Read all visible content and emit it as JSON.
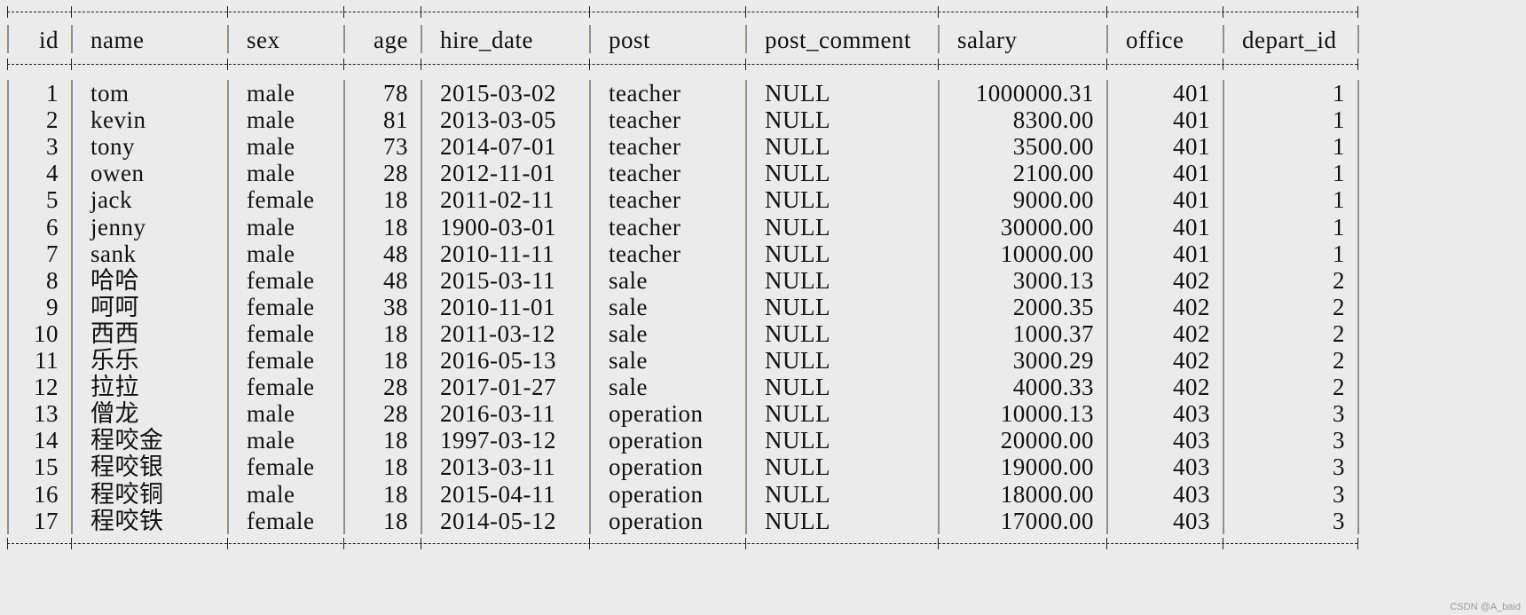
{
  "console": {
    "columns": [
      "id",
      "name",
      "sex",
      "age",
      "hire_date",
      "post",
      "post_comment",
      "salary",
      "office",
      "depart_id"
    ],
    "rows": [
      [
        "1",
        "tom",
        "male",
        "78",
        "2015-03-02",
        "teacher",
        "NULL",
        "1000000.31",
        "401",
        "1"
      ],
      [
        "2",
        "kevin",
        "male",
        "81",
        "2013-03-05",
        "teacher",
        "NULL",
        "8300.00",
        "401",
        "1"
      ],
      [
        "3",
        "tony",
        "male",
        "73",
        "2014-07-01",
        "teacher",
        "NULL",
        "3500.00",
        "401",
        "1"
      ],
      [
        "4",
        "owen",
        "male",
        "28",
        "2012-11-01",
        "teacher",
        "NULL",
        "2100.00",
        "401",
        "1"
      ],
      [
        "5",
        "jack",
        "female",
        "18",
        "2011-02-11",
        "teacher",
        "NULL",
        "9000.00",
        "401",
        "1"
      ],
      [
        "6",
        "jenny",
        "male",
        "18",
        "1900-03-01",
        "teacher",
        "NULL",
        "30000.00",
        "401",
        "1"
      ],
      [
        "7",
        "sank",
        "male",
        "48",
        "2010-11-11",
        "teacher",
        "NULL",
        "10000.00",
        "401",
        "1"
      ],
      [
        "8",
        "哈哈",
        "female",
        "48",
        "2015-03-11",
        "sale",
        "NULL",
        "3000.13",
        "402",
        "2"
      ],
      [
        "9",
        "呵呵",
        "female",
        "38",
        "2010-11-01",
        "sale",
        "NULL",
        "2000.35",
        "402",
        "2"
      ],
      [
        "10",
        "西西",
        "female",
        "18",
        "2011-03-12",
        "sale",
        "NULL",
        "1000.37",
        "402",
        "2"
      ],
      [
        "11",
        "乐乐",
        "female",
        "18",
        "2016-05-13",
        "sale",
        "NULL",
        "3000.29",
        "402",
        "2"
      ],
      [
        "12",
        "拉拉",
        "female",
        "28",
        "2017-01-27",
        "sale",
        "NULL",
        "4000.33",
        "402",
        "2"
      ],
      [
        "13",
        "僧龙",
        "male",
        "28",
        "2016-03-11",
        "operation",
        "NULL",
        "10000.13",
        "403",
        "3"
      ],
      [
        "14",
        "程咬金",
        "male",
        "18",
        "1997-03-12",
        "operation",
        "NULL",
        "20000.00",
        "403",
        "3"
      ],
      [
        "15",
        "程咬银",
        "female",
        "18",
        "2013-03-11",
        "operation",
        "NULL",
        "19000.00",
        "403",
        "3"
      ],
      [
        "16",
        "程咬铜",
        "male",
        "18",
        "2015-04-11",
        "operation",
        "NULL",
        "18000.00",
        "403",
        "3"
      ],
      [
        "17",
        "程咬铁",
        "female",
        "18",
        "2014-05-12",
        "operation",
        "NULL",
        "17000.00",
        "403",
        "3"
      ]
    ]
  },
  "watermark": "CSDN @A_baid"
}
